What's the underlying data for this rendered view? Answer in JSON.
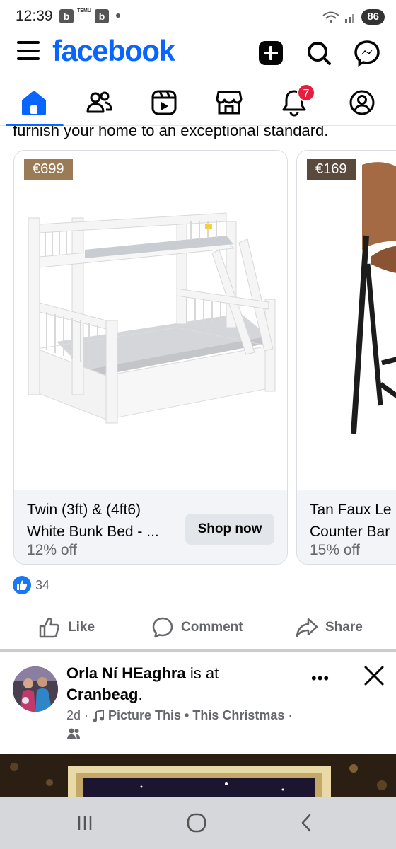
{
  "status_bar": {
    "time": "12:39",
    "app1": "b",
    "temu": "TEMU",
    "app2": "b",
    "battery": "86"
  },
  "header": {
    "logo": "facebook",
    "brand_color": "#0866ff",
    "icons": [
      "menu-icon",
      "plus-icon",
      "search-icon",
      "messenger-icon"
    ]
  },
  "nav": {
    "tabs": [
      {
        "name": "home",
        "icon": "home-icon",
        "active": true
      },
      {
        "name": "friends",
        "icon": "friends-icon"
      },
      {
        "name": "video",
        "icon": "video-icon"
      },
      {
        "name": "marketplace",
        "icon": "marketplace-icon"
      },
      {
        "name": "notifications",
        "icon": "bell-icon",
        "badge": "7"
      },
      {
        "name": "profile",
        "icon": "profile-icon"
      }
    ]
  },
  "feed": {
    "caption": "furnish your home to an exceptional standard.",
    "cards": [
      {
        "price": "€699",
        "title_line1": "Twin (3ft) & (4ft6)",
        "title_line2": "White Bunk Bed - ...",
        "discount": "12% off",
        "cta": "Shop now"
      },
      {
        "price": "€169",
        "title_line1": "Tan Faux Le",
        "title_line2": "Counter Bar",
        "discount": "15% off"
      }
    ],
    "reaction_count": "34",
    "actions": {
      "like": "Like",
      "comment": "Comment",
      "share": "Share"
    }
  },
  "post2": {
    "author": "Orla Ní HEaghra",
    "is_at": " is at",
    "place": "Cranbeag",
    "place_suffix": ".",
    "time": "2d",
    "separator": "·",
    "music": "Picture This • This Christmas",
    "trailing_sep": "·",
    "more": "•••"
  },
  "android_nav": [
    "recents-icon",
    "home-circle-icon",
    "back-icon"
  ]
}
